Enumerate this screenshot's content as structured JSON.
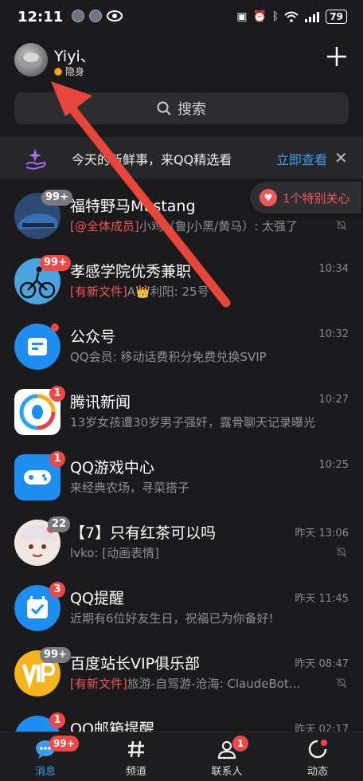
{
  "status_bar": {
    "time": "12:11",
    "battery": "79"
  },
  "header": {
    "user_name": "Yiyi、",
    "presence": "隐身"
  },
  "search": {
    "placeholder": "搜索"
  },
  "banner": {
    "text": "今天的新鲜事，来QQ精选看",
    "action": "立即查看"
  },
  "special_care": {
    "label": "1个特别关心"
  },
  "chats": [
    {
      "title": "福特野马Mustang",
      "tag": "[@全体成员]",
      "preview": "小鸡（鲁J小黑/黄马）: 太强了",
      "time": "",
      "badge": "99+",
      "badge_style": "gray",
      "muted": true
    },
    {
      "title": "孝感学院优秀兼职",
      "tag": "[有新文件]",
      "preview": "A👑利阳: 25号",
      "time": "10:34",
      "badge": "99+",
      "badge_style": "red",
      "muted": false
    },
    {
      "title": "公众号",
      "tag": "",
      "preview": "QQ会员: 移动话费积分免费兑换SVIP",
      "time": "10:32",
      "badge": "",
      "badge_style": "dot",
      "muted": false
    },
    {
      "title": "腾讯新闻",
      "tag": "",
      "preview": "13岁女孩遭30岁男子强奸，露骨聊天记录曝光",
      "time": "10:27",
      "badge": "1",
      "badge_style": "red",
      "muted": false
    },
    {
      "title": "QQ游戏中心",
      "tag": "",
      "preview": "来经典农场，寻菜搭子",
      "time": "10:25",
      "badge": "1",
      "badge_style": "red",
      "muted": false
    },
    {
      "title": "【7】只有红茶可以吗",
      "tag": "",
      "preview": "lvko: [动画表情]",
      "time": "昨天 13:06",
      "badge": "22",
      "badge_style": "gray",
      "muted": true
    },
    {
      "title": "QQ提醒",
      "tag": "",
      "preview": "近期有6位好友生日，祝福已为你备好!",
      "time": "昨天 11:45",
      "badge": "3",
      "badge_style": "red",
      "muted": false
    },
    {
      "title": "百度站长VIP俱乐部",
      "tag": "[有新文件]",
      "preview": "旅游-自驾游-沧海: ClaudeBot...",
      "time": "昨天 08:47",
      "badge": "99+",
      "badge_style": "gray",
      "muted": true
    },
    {
      "title": "QQ邮箱提醒",
      "tag": "",
      "preview": "",
      "time": "昨天 02:17",
      "badge": "1",
      "badge_style": "red",
      "muted": false
    }
  ],
  "tabs": [
    {
      "label": "消息",
      "badge": "99+",
      "active": true,
      "icon": "message-icon"
    },
    {
      "label": "频道",
      "badge": "",
      "active": false,
      "icon": "hashtag-icon"
    },
    {
      "label": "联系人",
      "badge": "1",
      "active": false,
      "icon": "contacts-icon"
    },
    {
      "label": "动态",
      "badge": "",
      "active": false,
      "icon": "moments-icon"
    }
  ],
  "colors": {
    "accent": "#3c9cf0",
    "badge_red": "#f04747",
    "arrow": "#e8463a",
    "background": "#1b1b1d"
  }
}
